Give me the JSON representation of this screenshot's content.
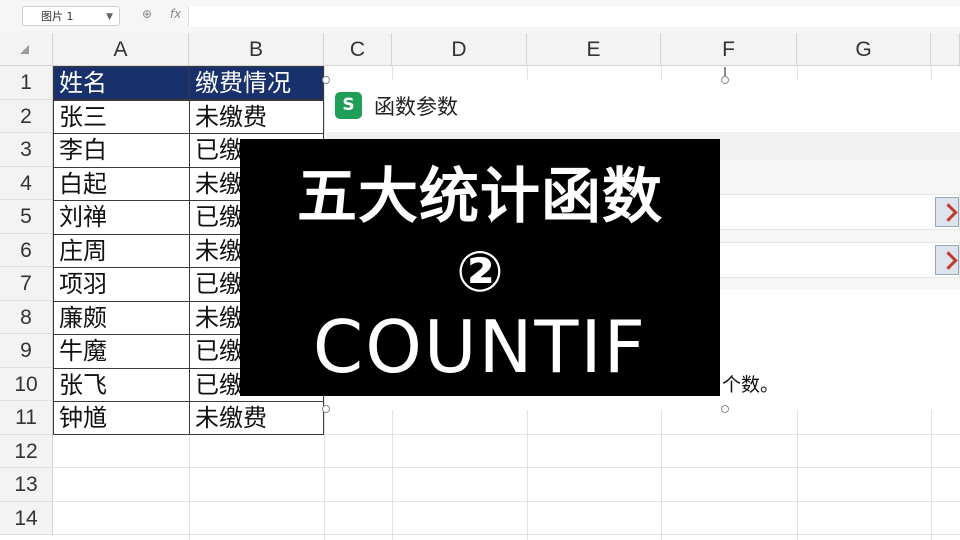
{
  "formula_bar": {
    "name_box": "图片 1",
    "fx_label": "fx"
  },
  "columns": [
    "A",
    "B",
    "C",
    "D",
    "E",
    "F",
    "G"
  ],
  "rows": [
    "1",
    "2",
    "3",
    "4",
    "5",
    "6",
    "7",
    "8",
    "9",
    "10",
    "11",
    "12",
    "13",
    "14"
  ],
  "table": {
    "header": [
      "姓名",
      "缴费情况"
    ],
    "rows": [
      [
        "张三",
        "未缴费"
      ],
      [
        "李白",
        "已缴"
      ],
      [
        "白起",
        "未缴"
      ],
      [
        "刘禅",
        "已缴"
      ],
      [
        "庄周",
        "未缴"
      ],
      [
        "项羽",
        "已缴"
      ],
      [
        "廉颇",
        "未缴"
      ],
      [
        "牛魔",
        "已缴"
      ],
      [
        "张飞",
        "已缴费"
      ],
      [
        "钟馗",
        "未缴费"
      ]
    ]
  },
  "dialog": {
    "logo": "S",
    "title": "函数参数",
    "description_tail": "个数。"
  },
  "overlay": {
    "line1": "五大统计函数",
    "line2": "②",
    "line3": "COUNTIF"
  },
  "colors": {
    "header_fill": "#18306b",
    "overlay_bg": "#000000",
    "logo_green": "#1f9e57"
  }
}
